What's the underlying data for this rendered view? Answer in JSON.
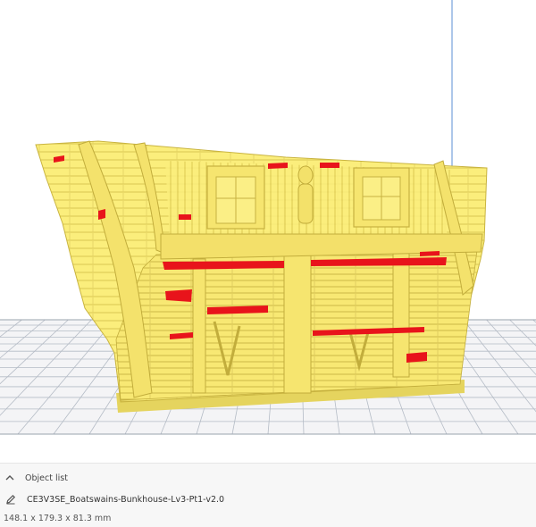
{
  "panel": {
    "object_list_label": "Object list",
    "object_name": "CE3V3SE_Boatswains-Bunkhouse-Lv3-Pt1-v2.0",
    "dimensions": "148.1 x 179.3 x 81.3 mm"
  },
  "icons": {
    "collapse": "chevron-up-icon",
    "edit": "pencil-icon"
  },
  "colors": {
    "model": "#fbee7c",
    "model_shadow": "#d6c34a",
    "overhang": "#e8141b",
    "build_plate_lines": "#b5bcc6",
    "build_volume_edge": "#5b8fd6"
  }
}
